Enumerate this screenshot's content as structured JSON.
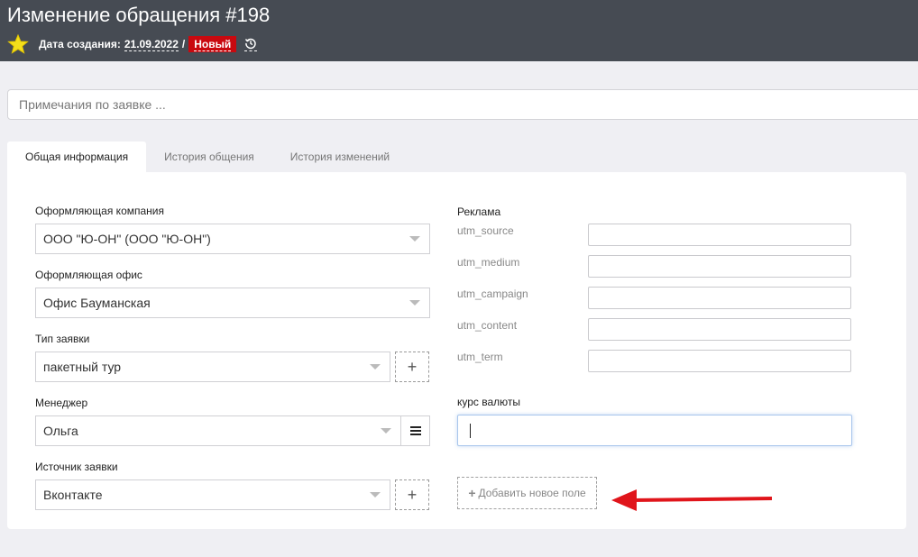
{
  "header": {
    "title": "Изменение обращения #198",
    "created_label": "Дата создания:",
    "created_date": "21.09.2022",
    "separator": "/",
    "status": "Новый",
    "status_color": "#c9090f",
    "background": "#464b53"
  },
  "notes": {
    "placeholder": "Примечания по заявке ..."
  },
  "tabs": [
    {
      "label": "Общая информация",
      "active": true
    },
    {
      "label": "История общения",
      "active": false
    },
    {
      "label": "История изменений",
      "active": false
    }
  ],
  "left": {
    "company": {
      "label": "Оформляющая компания",
      "value": "ООО \"Ю-ОН\" (ООО \"Ю-ОН\")"
    },
    "office": {
      "label": "Оформляющая офис",
      "value": "Офис Бауманская"
    },
    "request_type": {
      "label": "Тип заявки",
      "value": "пакетный тур",
      "add_icon": "+"
    },
    "manager": {
      "label": "Менеджер",
      "value": "Ольга"
    },
    "source": {
      "label": "Источник заявки",
      "value": "Вконтакте",
      "add_icon": "+"
    }
  },
  "right": {
    "ads_label": "Реклама",
    "utm": [
      {
        "label": "utm_source",
        "value": ""
      },
      {
        "label": "utm_medium",
        "value": ""
      },
      {
        "label": "utm_campaign",
        "value": ""
      },
      {
        "label": "utm_content",
        "value": ""
      },
      {
        "label": "utm_term",
        "value": ""
      }
    ],
    "currency": {
      "label": "курс валюты",
      "value": ""
    },
    "add_field": {
      "plus": "+",
      "label": "Добавить новое поле"
    }
  },
  "annotation": {
    "arrow_color": "#e0151b"
  }
}
